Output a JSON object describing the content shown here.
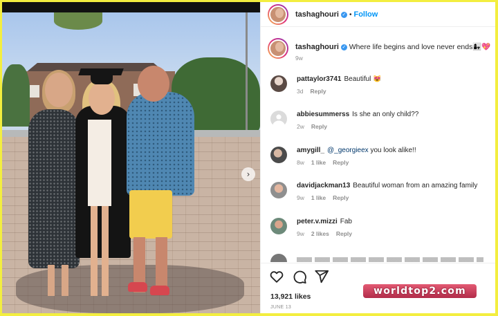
{
  "post": {
    "username": "tashaghouri",
    "follow_label": "Follow",
    "caption": "Where life begins and love never ends👩‍👧💖",
    "caption_age": "9w",
    "likes": "13,921 likes",
    "date": "JUNE 13"
  },
  "comments": [
    {
      "user": "pattaylor3741",
      "text": "Beautiful 😻",
      "age": "3d",
      "likes": "",
      "reply": "Reply"
    },
    {
      "user": "abbiesummerss",
      "text": "Is she an only child??",
      "age": "2w",
      "likes": "",
      "reply": "Reply"
    },
    {
      "user": "amygill_",
      "mention": "@_georgieex",
      "text": " you look alike!!",
      "age": "8w",
      "likes": "1 like",
      "reply": "Reply"
    },
    {
      "user": "davidjackman13",
      "text": "Beautiful woman from an amazing family",
      "age": "9w",
      "likes": "1 like",
      "reply": "Reply"
    },
    {
      "user": "peter.v.mizzi",
      "text": "Fab",
      "age": "9w",
      "likes": "2 likes",
      "reply": "Reply"
    }
  ],
  "watermark": "worldtop2.com",
  "icons": [
    "heart-icon",
    "comment-icon",
    "share-icon",
    "carousel-next-icon",
    "verified-badge-icon"
  ],
  "colors": {
    "frame": "#f3ee3f",
    "follow": "#0095f6",
    "verified": "#3897f0",
    "meta": "#8e8e8e"
  }
}
